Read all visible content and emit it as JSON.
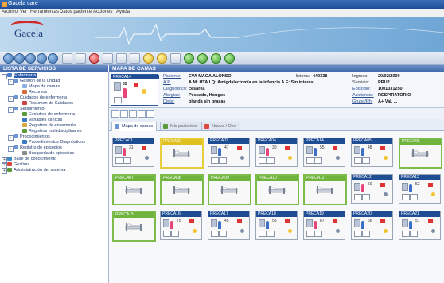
{
  "title": "Gacela care",
  "menu": [
    "Archivo",
    "Ver",
    "Herramientas",
    "Datos paciente",
    "Acciones",
    "Ayuda"
  ],
  "logo_text": "Gacela",
  "left_panel": {
    "header": "LISTA DE SERVICIOS",
    "tree": [
      {
        "label": "Enfermería",
        "level": 0,
        "selected": true,
        "icon": "folder-icon"
      },
      {
        "label": "Gestión de la unidad",
        "level": 1,
        "icon": "folder-icon"
      },
      {
        "label": "Mapa de camas",
        "level": 2,
        "icon": "bed-icon"
      },
      {
        "label": "Recursos",
        "level": 2,
        "icon": "people-icon"
      },
      {
        "label": "Cuidados de enfermería",
        "level": 1,
        "icon": "folder-icon"
      },
      {
        "label": "Resumen de Cuidados",
        "level": 2,
        "icon": "document-icon"
      },
      {
        "label": "Seguimiento",
        "level": 1,
        "icon": "folder-icon"
      },
      {
        "label": "Evolutivo de enfermería",
        "level": 2,
        "icon": "document-icon"
      },
      {
        "label": "Variables clínicas",
        "level": 2,
        "icon": "chart-icon"
      },
      {
        "label": "Registros de enfermería",
        "level": 2,
        "icon": "document-icon"
      },
      {
        "label": "Registros multidisciplinares",
        "level": 2,
        "icon": "document-icon"
      },
      {
        "label": "Procedimientos",
        "level": 1,
        "icon": "folder-icon"
      },
      {
        "label": "Procedimientos Diagnósticos",
        "level": 2,
        "icon": "tool-icon"
      },
      {
        "label": "Registro de episodios",
        "level": 1,
        "icon": "folder-icon"
      },
      {
        "label": "Búsqueda de episodios",
        "level": 2,
        "icon": "search-icon"
      },
      {
        "label": "Base de conocimiento",
        "level": 0,
        "icon": "folder-icon"
      },
      {
        "label": "Gestión",
        "level": 0,
        "icon": "folder-icon"
      },
      {
        "label": "Administración del sistema",
        "level": 0,
        "icon": "folder-icon"
      }
    ]
  },
  "right_panel": {
    "header": "MAPA DE CAMAS",
    "selected_bed": {
      "code": "PRECA14",
      "number": "55"
    },
    "patient": {
      "labels": [
        "Paciente:",
        "A.P.",
        "Diagnóstico:",
        "Alergias:",
        "Dieta:"
      ],
      "values": [
        "EVA MAGA ALONSO",
        "A.M: HTA I.Q: Amigdalectomía en la infancia A.F: Sin interés ...",
        "cesarea",
        "Pescado, Hongos",
        "blanda sin grasas"
      ],
      "historia_label": "Historia:",
      "historia_value": "440338",
      "right_labels": [
        "Ingreso:",
        "Servicio:",
        "Episodio:",
        "Asistencia:",
        "Grupo/Rh:"
      ],
      "right_values": [
        "20/02/2009",
        "PRU2",
        "1001031250",
        "RESPIRATORIO",
        "A+ Val. ..."
      ]
    },
    "tabs": [
      "Mapa de camas",
      "Mis pacientes",
      "Nuevo / Otro"
    ],
    "beds": [
      {
        "code": "PRECA01",
        "status": "occ",
        "num": "31"
      },
      {
        "code": "PRECA02",
        "status": "res",
        "num": ""
      },
      {
        "code": "PRECA03",
        "status": "occ",
        "num": "47"
      },
      {
        "code": "PRECA04",
        "status": "occ",
        "num": "30"
      },
      {
        "code": "PRECA14",
        "status": "occ",
        "num": "55"
      },
      {
        "code": "PRECA05",
        "status": "occ",
        "num": "48"
      },
      {
        "code": "PRECA06",
        "status": "free",
        "num": ""
      },
      {
        "code": "PRECA07",
        "status": "free",
        "num": ""
      },
      {
        "code": "PRECA08",
        "status": "free",
        "num": ""
      },
      {
        "code": "PRECA09",
        "status": "free",
        "num": ""
      },
      {
        "code": "PRECA10",
        "status": "free",
        "num": ""
      },
      {
        "code": "PRECA11",
        "status": "free",
        "num": ""
      },
      {
        "code": "PRECA12",
        "status": "occ",
        "num": "50"
      },
      {
        "code": "PRECA13",
        "status": "occ",
        "num": "52"
      },
      {
        "code": "PRECA15",
        "status": "free",
        "num": ""
      },
      {
        "code": "PRECA16",
        "status": "occ",
        "num": "75"
      },
      {
        "code": "PRECA17",
        "status": "occ",
        "num": "45"
      },
      {
        "code": "PRECA18",
        "status": "occ",
        "num": "58"
      },
      {
        "code": "PRECA19",
        "status": "occ",
        "num": "87"
      },
      {
        "code": "PRECA20",
        "status": "occ",
        "num": "66"
      },
      {
        "code": "PRECA21",
        "status": "occ",
        "num": "51"
      }
    ]
  }
}
